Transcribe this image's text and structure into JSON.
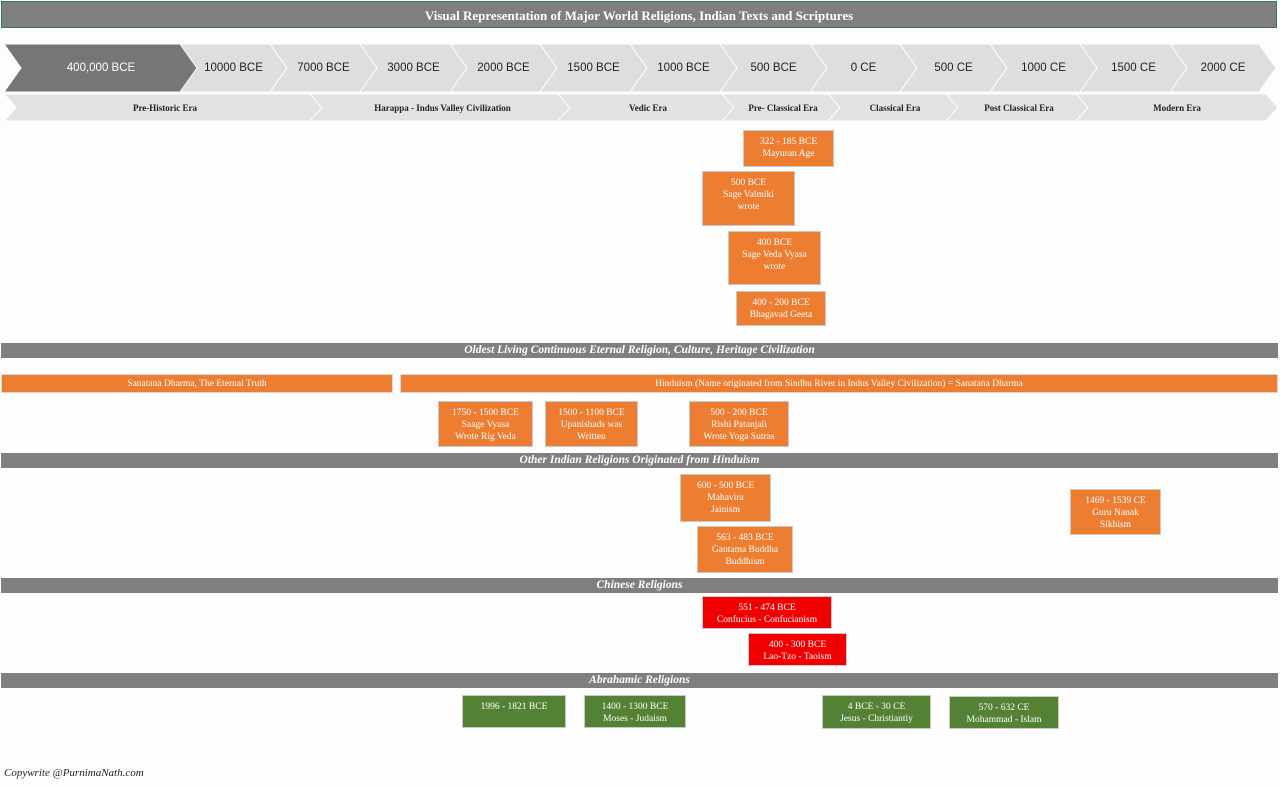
{
  "title": "Visual Representation of Major World Religions,  Indian Texts  and Scriptures",
  "timeline": [
    "400,000 BCE",
    "10000 BCE",
    "7000 BCE",
    "3000 BCE",
    "2000 BCE",
    "1500 BCE",
    "1000 BCE",
    "500 BCE",
    "0 CE",
    "500 CE",
    "1000 CE",
    "1500 CE",
    "2000 CE"
  ],
  "eras": [
    "Pre-Historic Era",
    "Harappa - Indus Valley Civilization",
    "Vedic Era",
    "Pre- Classical Era",
    "Classical Era",
    "Post Classical Era",
    "Modern Era"
  ],
  "top_events": [
    {
      "line1": "322 - 185 BCE",
      "line2": "Mayuran Age",
      "line3": ""
    },
    {
      "line1": "500 BCE",
      "line2": "Sage Valmiki",
      "line3": "wrote"
    },
    {
      "line1": "400 BCE",
      "line2": "Sage Veda Vyasa",
      "line3": "wrote"
    },
    {
      "line1": "400 - 200 BCE",
      "line2": "Bhagavad Geeta",
      "line3": ""
    }
  ],
  "sections": {
    "oldest": "Oldest Living Continuous Eternal Religion, Culture, Heritage Civilization",
    "other_indian": "Other Indian Religions Originated from Hinduism",
    "chinese": "Chinese Religions",
    "abrahamic": "Abrahamic Religions"
  },
  "sanatana": "Sanatana Dharma, The Eternal Truth",
  "hinduism": "Hinduism (Name originated from Sindhu River in Indus Valley Civilization) = Sanatana Dharma",
  "hindu_events": [
    {
      "line1": "1750 - 1500 BCE",
      "line2": "Saage Vyasa",
      "line3": "Wrote Rig Veda"
    },
    {
      "line1": "1500 - 1100 BCE",
      "line2": "Upanishads was",
      "line3": "Written"
    },
    {
      "line1": "500 - 200 BCE",
      "line2": "Rishi Patanjali",
      "line3": "Wrote Yoga Sutras"
    }
  ],
  "indian_events": [
    {
      "line1": "600 - 500 BCE",
      "line2": "Mahavira",
      "line3": "Jainism"
    },
    {
      "line1": "563 - 483 BCE",
      "line2": "Gautama Buddha",
      "line3": "Buddhism"
    },
    {
      "line1": "1469 - 1539 CE",
      "line2": "Guru Nanak",
      "line3": "Sikhism"
    }
  ],
  "chinese_events": [
    {
      "line1": "551 - 474 BCE",
      "line2": "Confucius - Confucianism"
    },
    {
      "line1": "400 - 300 BCE",
      "line2": "Lao-Tzo - Taoism"
    }
  ],
  "abrahamic_events": [
    {
      "line1": "1996 - 1821 BCE",
      "line2": ""
    },
    {
      "line1": "1400 - 1300 BCE",
      "line2": "Moses - Judaism"
    },
    {
      "line1": "4 BCE - 30 CE",
      "line2": "Jesus - Christiantiy"
    },
    {
      "line1": "570 - 632 CE",
      "line2": "Mohammad - Islam"
    }
  ],
  "footer": "Copywrite @PurnimaNath.com",
  "colors": {
    "orange": "#ed7d31",
    "red": "#f00000",
    "green": "#548235",
    "band": "#7f7f7f"
  }
}
